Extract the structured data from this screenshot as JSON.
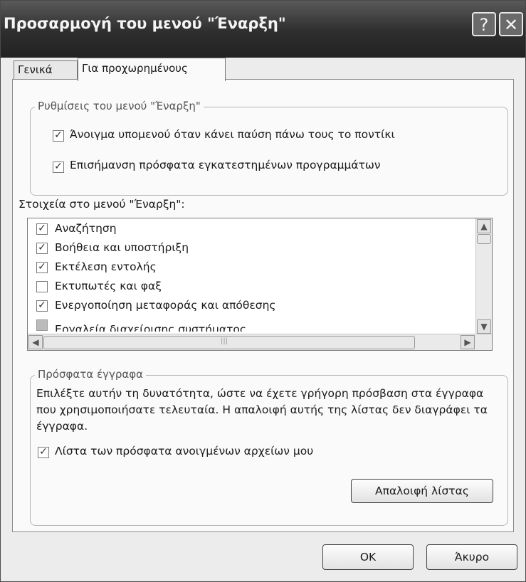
{
  "window": {
    "title": "Προσαρμογή του μενού \"Έναρξη\"",
    "help_label": "?",
    "close_label": "✕"
  },
  "tabs": [
    {
      "label": "Γενικά"
    },
    {
      "label": "Για προχωρημένους"
    }
  ],
  "start_menu_settings": {
    "legend": "Ρυθμίσεις του μενού \"Έναρξη\"",
    "options": [
      {
        "label": "Άνοιγμα υπομενού όταν κάνει παύση πάνω τους το ποντίκι",
        "checked": true
      },
      {
        "label": "Επισήμανση πρόσφατα εγκατεστημένων προγραμμάτων",
        "checked": true
      }
    ]
  },
  "items_section": {
    "label": "Στοιχεία στο μενού \"Έναρξη\":",
    "items": [
      {
        "label": "Αναζήτηση",
        "checked": true
      },
      {
        "label": "Βοήθεια και υποστήριξη",
        "checked": true
      },
      {
        "label": "Εκτέλεση εντολής",
        "checked": true
      },
      {
        "label": "Εκτυπωτές και φαξ",
        "checked": false
      },
      {
        "label": "Ενεργοποίηση μεταφοράς και απόθεσης",
        "checked": true
      },
      {
        "label": "Εργαλεία διαχείρισης συστήματος",
        "checked": false
      }
    ]
  },
  "recent_documents": {
    "legend": "Πρόσφατα έγγραφα",
    "description": "Επιλέξτε αυτήν τη δυνατότητα, ώστε να έχετε γρήγορη πρόσβαση στα έγγραφα που χρησιμοποιήσατε τελευταία. Η απαλοιφή αυτής της λίστας δεν διαγράφει τα έγγραφα.",
    "option_label": "Λίστα των πρόσφατα ανοιγμένων αρχείων μου",
    "option_checked": true,
    "clear_button": "Απαλοιφή λίστας"
  },
  "footer": {
    "ok": "OK",
    "cancel": "Άκυρο"
  },
  "icons": {
    "check": "checkmark-icon",
    "up": "scroll-up-icon",
    "down": "scroll-down-icon",
    "left": "scroll-left-icon",
    "right": "scroll-right-icon"
  }
}
